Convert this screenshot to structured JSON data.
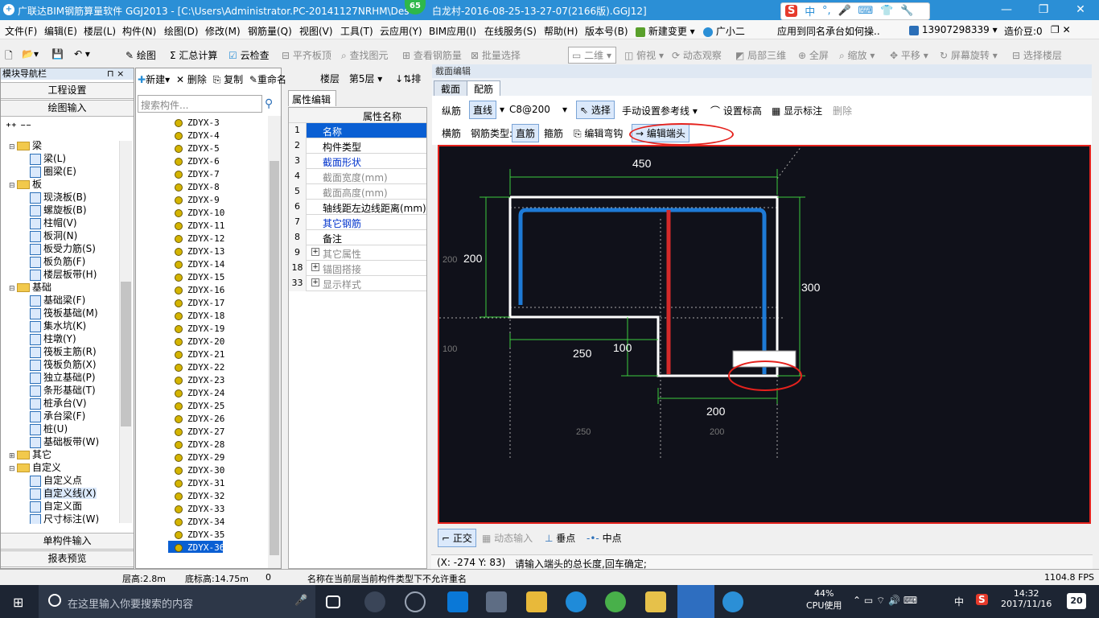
{
  "titlebar": {
    "title": "广联达BIM钢筋算量软件 GGJ2013 - [C:\\Users\\Administrator.PC-20141127NRHM\\Des",
    "title_tail": "白龙村-2016-08-25-13-27-07(2166版).GGJ12]",
    "badge": "65",
    "ime_labels": [
      "中",
      "°,",
      "🎤",
      "⌨",
      "👕",
      "🔧"
    ],
    "min": "—",
    "restore": "❐",
    "close": "✕"
  },
  "menu": {
    "items": [
      "文件(F)",
      "编辑(E)",
      "楼层(L)",
      "构件(N)",
      "绘图(D)",
      "修改(M)",
      "钢筋量(Q)",
      "视图(V)",
      "工具(T)",
      "云应用(Y)",
      "BIM应用(I)",
      "在线服务(S)",
      "帮助(H)",
      "版本号(B)",
      "新建变更",
      "广小二",
      "应用到同名承台如何操..",
      "13907298339",
      "造价豆:0"
    ]
  },
  "toolbar": {
    "items": [
      "绘图",
      "Σ 汇总计算",
      "云检查",
      "平齐板顶",
      "查找图元",
      "查看钢筋量",
      "批量选择",
      "二维",
      "俯视",
      "动态观察",
      "局部三维",
      "全屏",
      "缩放",
      "平移",
      "屏幕旋转",
      "选择楼层"
    ]
  },
  "nav": {
    "header": "模块导航栏",
    "pin": "⊓ ×",
    "btn_project": "工程设置",
    "btn_draw": "绘图输入",
    "btn_single": "单构件输入",
    "btn_report": "报表预览",
    "tree": [
      {
        "label": "梁",
        "level": 0,
        "type": "folder",
        "exp": "⊟"
      },
      {
        "label": "梁(L)",
        "level": 1,
        "type": "item"
      },
      {
        "label": "圈梁(E)",
        "level": 1,
        "type": "item"
      },
      {
        "label": "板",
        "level": 0,
        "type": "folder",
        "exp": "⊟"
      },
      {
        "label": "现浇板(B)",
        "level": 1,
        "type": "item"
      },
      {
        "label": "螺旋板(B)",
        "level": 1,
        "type": "item"
      },
      {
        "label": "柱帽(V)",
        "level": 1,
        "type": "item"
      },
      {
        "label": "板洞(N)",
        "level": 1,
        "type": "item"
      },
      {
        "label": "板受力筋(S)",
        "level": 1,
        "type": "item"
      },
      {
        "label": "板负筋(F)",
        "level": 1,
        "type": "item"
      },
      {
        "label": "楼层板带(H)",
        "level": 1,
        "type": "item"
      },
      {
        "label": "基础",
        "level": 0,
        "type": "folder",
        "exp": "⊟"
      },
      {
        "label": "基础梁(F)",
        "level": 1,
        "type": "item"
      },
      {
        "label": "筏板基础(M)",
        "level": 1,
        "type": "item"
      },
      {
        "label": "集水坑(K)",
        "level": 1,
        "type": "item"
      },
      {
        "label": "柱墩(Y)",
        "level": 1,
        "type": "item"
      },
      {
        "label": "筏板主筋(R)",
        "level": 1,
        "type": "item"
      },
      {
        "label": "筏板负筋(X)",
        "level": 1,
        "type": "item"
      },
      {
        "label": "独立基础(P)",
        "level": 1,
        "type": "item"
      },
      {
        "label": "条形基础(T)",
        "level": 1,
        "type": "item"
      },
      {
        "label": "桩承台(V)",
        "level": 1,
        "type": "item"
      },
      {
        "label": "承台梁(F)",
        "level": 1,
        "type": "item"
      },
      {
        "label": "桩(U)",
        "level": 1,
        "type": "item"
      },
      {
        "label": "基础板带(W)",
        "level": 1,
        "type": "item"
      },
      {
        "label": "其它",
        "level": 0,
        "type": "folder",
        "exp": "⊞"
      },
      {
        "label": "自定义",
        "level": 0,
        "type": "folder",
        "exp": "⊟"
      },
      {
        "label": "自定义点",
        "level": 1,
        "type": "item"
      },
      {
        "label": "自定义线(X)",
        "level": 1,
        "type": "item"
      },
      {
        "label": "自定义面",
        "level": 1,
        "type": "item"
      },
      {
        "label": "尺寸标注(W)",
        "level": 1,
        "type": "item"
      }
    ]
  },
  "components": {
    "toolbar": [
      "新建",
      "删除",
      "复制",
      "重命名",
      "楼层",
      "第5层",
      "排"
    ],
    "search_placeholder": "搜索构件...",
    "items": [
      "ZDYX-3",
      "ZDYX-4",
      "ZDYX-5",
      "ZDYX-6",
      "ZDYX-7",
      "ZDYX-8",
      "ZDYX-9",
      "ZDYX-10",
      "ZDYX-11",
      "ZDYX-12",
      "ZDYX-13",
      "ZDYX-14",
      "ZDYX-15",
      "ZDYX-16",
      "ZDYX-17",
      "ZDYX-18",
      "ZDYX-19",
      "ZDYX-20",
      "ZDYX-21",
      "ZDYX-22",
      "ZDYX-23",
      "ZDYX-24",
      "ZDYX-25",
      "ZDYX-26",
      "ZDYX-27",
      "ZDYX-28",
      "ZDYX-29",
      "ZDYX-30",
      "ZDYX-31",
      "ZDYX-32",
      "ZDYX-33",
      "ZDYX-34",
      "ZDYX-35",
      "ZDYX-36"
    ],
    "selected": "ZDYX-36"
  },
  "properties": {
    "tab": "属性编辑",
    "header": "属性名称",
    "rows": [
      {
        "no": "1",
        "label": "名称",
        "style": "selected"
      },
      {
        "no": "2",
        "label": "构件类型",
        "style": "normal"
      },
      {
        "no": "3",
        "label": "截面形状",
        "style": "blue"
      },
      {
        "no": "4",
        "label": "截面宽度(mm)",
        "style": "gray"
      },
      {
        "no": "5",
        "label": "截面高度(mm)",
        "style": "gray"
      },
      {
        "no": "6",
        "label": "轴线距左边线距离(mm)",
        "style": "normal"
      },
      {
        "no": "7",
        "label": "其它钢筋",
        "style": "blue"
      },
      {
        "no": "8",
        "label": "备注",
        "style": "normal"
      },
      {
        "no": "9",
        "label": "其它属性",
        "style": "gray",
        "plus": true
      },
      {
        "no": "18",
        "label": "锚固搭接",
        "style": "gray",
        "plus": true
      },
      {
        "no": "33",
        "label": "显示样式",
        "style": "gray",
        "plus": true
      }
    ]
  },
  "editor": {
    "title": "截面编辑",
    "tabs": [
      "截面",
      "配筋"
    ],
    "row1": {
      "long": "纵筋",
      "line": "直线",
      "spec": "C8@200",
      "select": "选择",
      "manual": "手动设置参考线",
      "elev": "设置标高",
      "show": "显示标注",
      "del": "删除"
    },
    "row2": {
      "trans": "横筋",
      "rebar_type": "钢筋类型:",
      "straight": "直筋",
      "stirrup": "箍筋",
      "edit_hook": "编辑弯钩",
      "edit_end": "编辑端头"
    },
    "dims": {
      "top": "450",
      "left": "200",
      "left_small": "200",
      "right": "300",
      "mid": "250",
      "inner": "100",
      "left2": "100",
      "bottom": "200",
      "ghost1": "250",
      "ghost2": "200"
    },
    "bottom_tools": [
      "正交",
      "动态输入",
      "垂点",
      "中点"
    ],
    "coords": "(X: -274 Y: 83)",
    "prompt": "请输入端头的总长度,回车确定;",
    "colors": {
      "canvas": "#10111a",
      "outline": "#ffffff",
      "blue_bar": "#1e7ad6",
      "red_bar": "#d42a2a",
      "dim": "#3dcc3d",
      "highlight": "#e5221d"
    }
  },
  "statusbar": {
    "floor_h": "层高:2.8m",
    "base_h": "底标高:14.75m",
    "zero": "0",
    "msg": "名称在当前层当前构件类型下不允许重名",
    "fps": "1104.8 FPS"
  },
  "taskbar": {
    "search": "在这里输入你要搜索的内容",
    "cpu": "44%",
    "cpu_label": "CPU使用",
    "ime": "中",
    "time": "14:32",
    "date": "2017/11/16",
    "notif": "20"
  }
}
